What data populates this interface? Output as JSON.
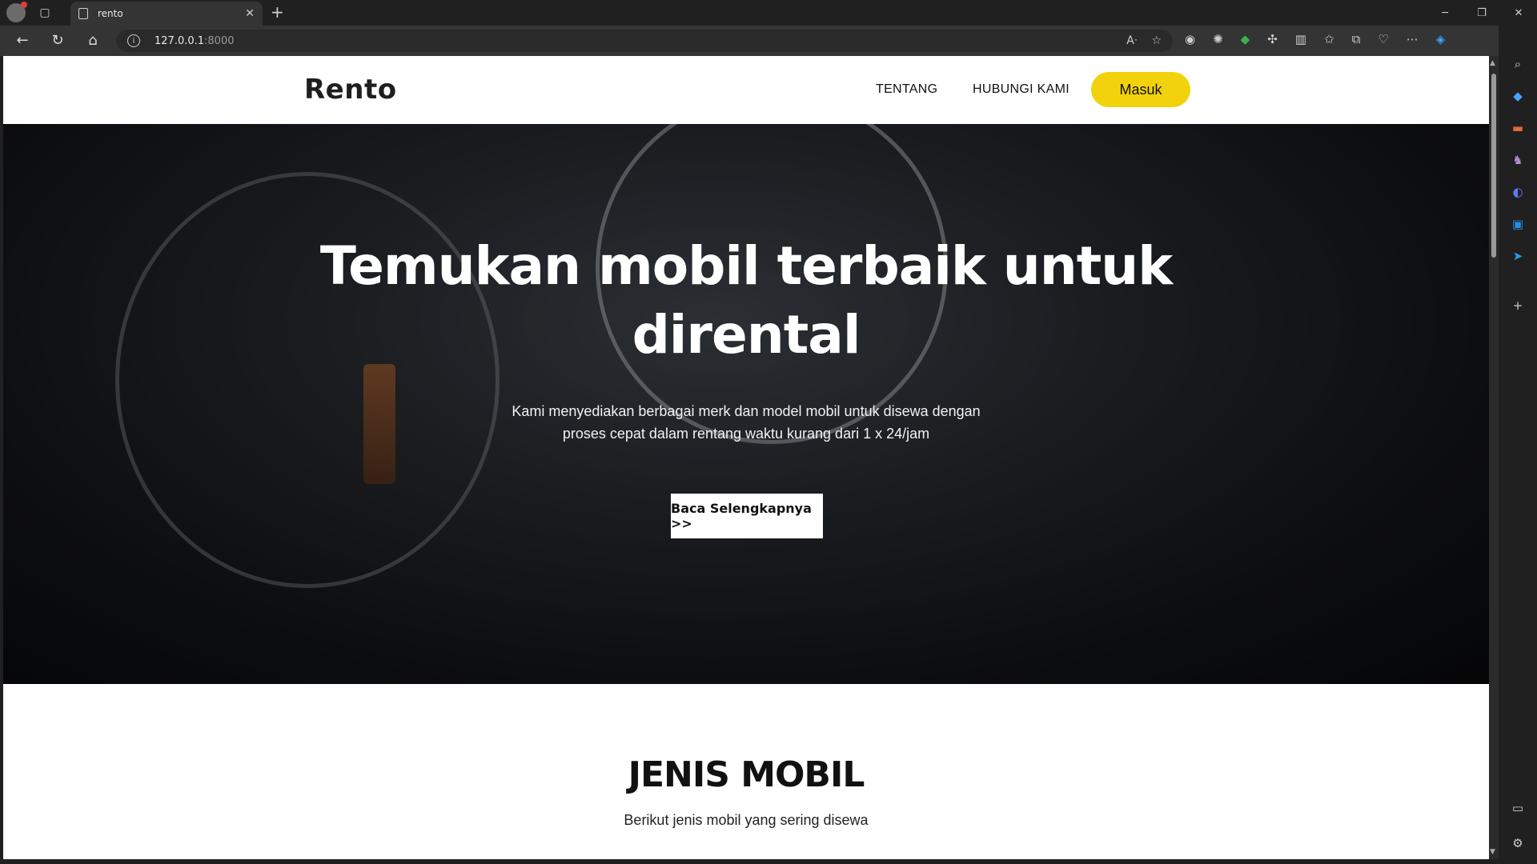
{
  "browser": {
    "tab_title": "rento",
    "url_host": "127.0.0.1",
    "url_port": ":8000",
    "window_controls": [
      "─",
      "❐",
      "✕"
    ]
  },
  "site": {
    "logo": "Rento",
    "nav": {
      "about": "TENTANG",
      "contact": "HUBUNGI KAMI",
      "login": "Masuk"
    },
    "hero": {
      "title_line1": "Temukan mobil terbaik untuk",
      "title_line2": "dirental",
      "subtitle_line1": "Kami menyediakan berbagai merk dan model mobil untuk disewa dengan",
      "subtitle_line2": "proses cepat dalam rentang waktu kurang dari 1 x 24/jam",
      "cta": "Baca Selengkapnya >>"
    },
    "section": {
      "title": "JENIS MOBIL",
      "subtitle": "Berikut jenis mobil yang sering disewa"
    }
  },
  "colors": {
    "accent": "#f2d20c",
    "chrome_dark": "#202020",
    "chrome_mid": "#343434"
  }
}
